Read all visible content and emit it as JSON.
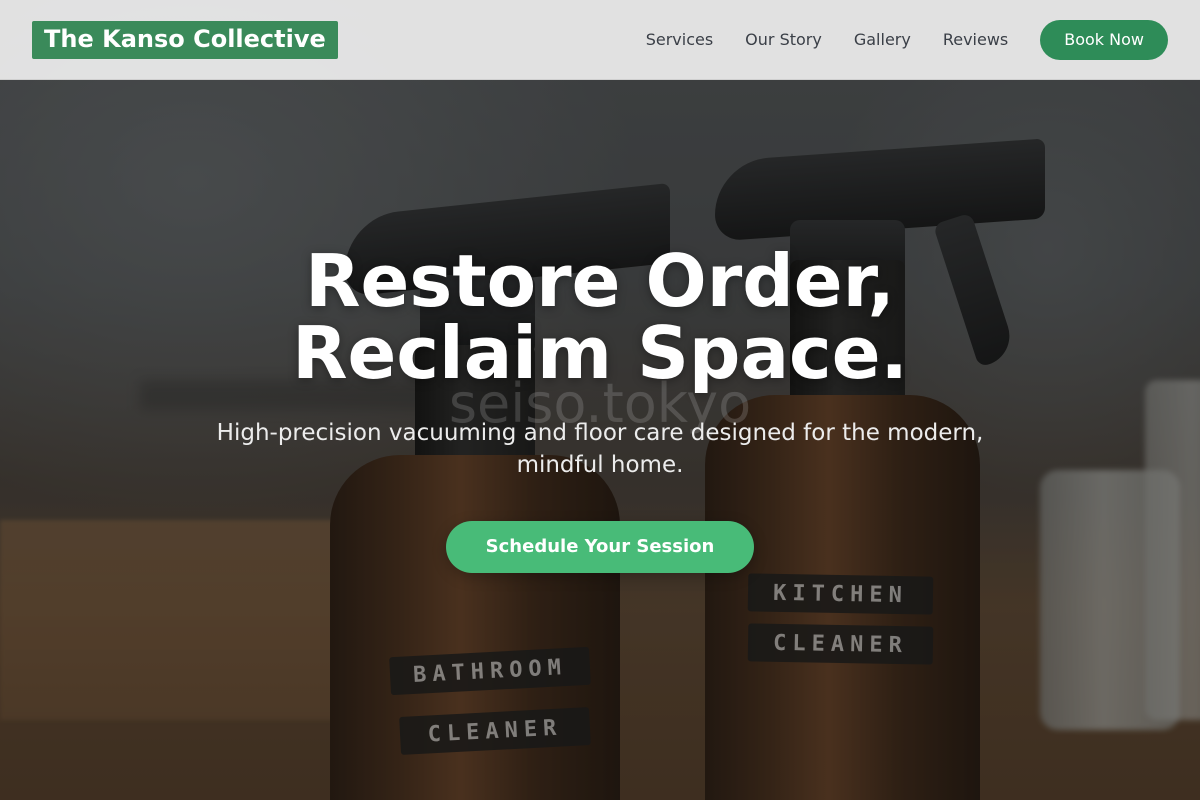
{
  "brand": {
    "name": "The Kanso Collective",
    "accent_color": "#3a8a5a"
  },
  "nav": {
    "links": [
      {
        "label": "Services"
      },
      {
        "label": "Our Story"
      },
      {
        "label": "Gallery"
      },
      {
        "label": "Reviews"
      }
    ],
    "book_label": "Book Now",
    "book_color": "#2e8c58"
  },
  "hero": {
    "title_line_1": "Restore Order,",
    "title_line_2": "Reclaim Space.",
    "subtitle": "High-precision vacuuming and floor care designed for the modern, mindful home.",
    "cta_label": "Schedule Your Session",
    "cta_color": "#48bb78",
    "watermark": "seiso.tokyo",
    "image_labels": {
      "left_bottle_line_1": "BATHROOM",
      "left_bottle_line_2": "CLEANER",
      "right_bottle_line_1": "KITCHEN",
      "right_bottle_line_2": "CLEANER"
    }
  }
}
